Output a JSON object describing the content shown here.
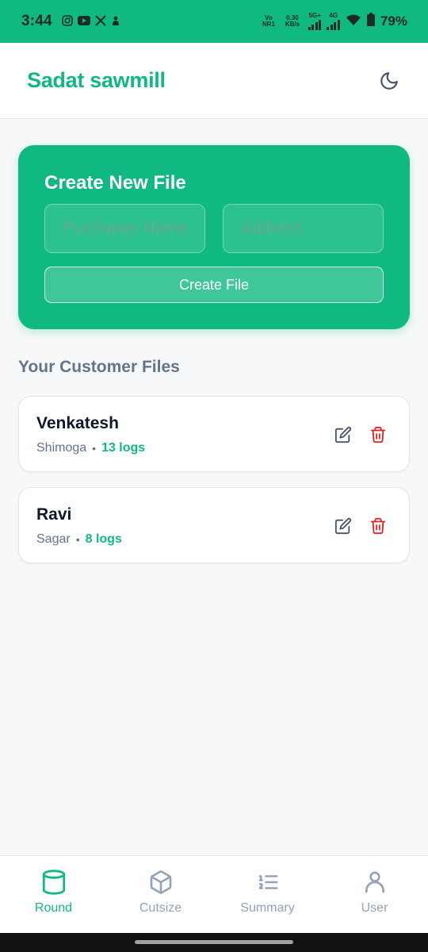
{
  "status_bar": {
    "time": "3:44",
    "app_icons": [
      "instagram-icon",
      "youtube-icon",
      "x-icon",
      "notification-icon"
    ],
    "network_volte": "Vo NR1",
    "net_speed": "0.30 KB/s",
    "signal_5g": "5G+",
    "signal_4g": "4G",
    "battery": "79%"
  },
  "app_bar": {
    "title": "Sadat sawmill",
    "theme_icon": "moon-icon"
  },
  "create_card": {
    "title": "Create New File",
    "purchaser_placeholder": "Purchaser Name",
    "purchaser_value": "",
    "address_placeholder": "Address",
    "address_value": "",
    "button_label": "Create File"
  },
  "files_section": {
    "heading": "Your Customer Files",
    "files": [
      {
        "name": "Venkatesh",
        "place": "Shimoga",
        "logs": "13 logs"
      },
      {
        "name": "Ravi",
        "place": "Sagar",
        "logs": "8 logs"
      }
    ]
  },
  "bottom_nav": {
    "items": [
      {
        "label": "Round",
        "icon": "cylinder-icon",
        "active": true
      },
      {
        "label": "Cutsize",
        "icon": "box-icon",
        "active": false
      },
      {
        "label": "Summary",
        "icon": "list-ordered-icon",
        "active": false
      },
      {
        "label": "User",
        "icon": "user-icon",
        "active": false
      }
    ]
  },
  "colors": {
    "accent": "#10b981",
    "danger": "#dc2626",
    "text_muted": "#64748b"
  }
}
